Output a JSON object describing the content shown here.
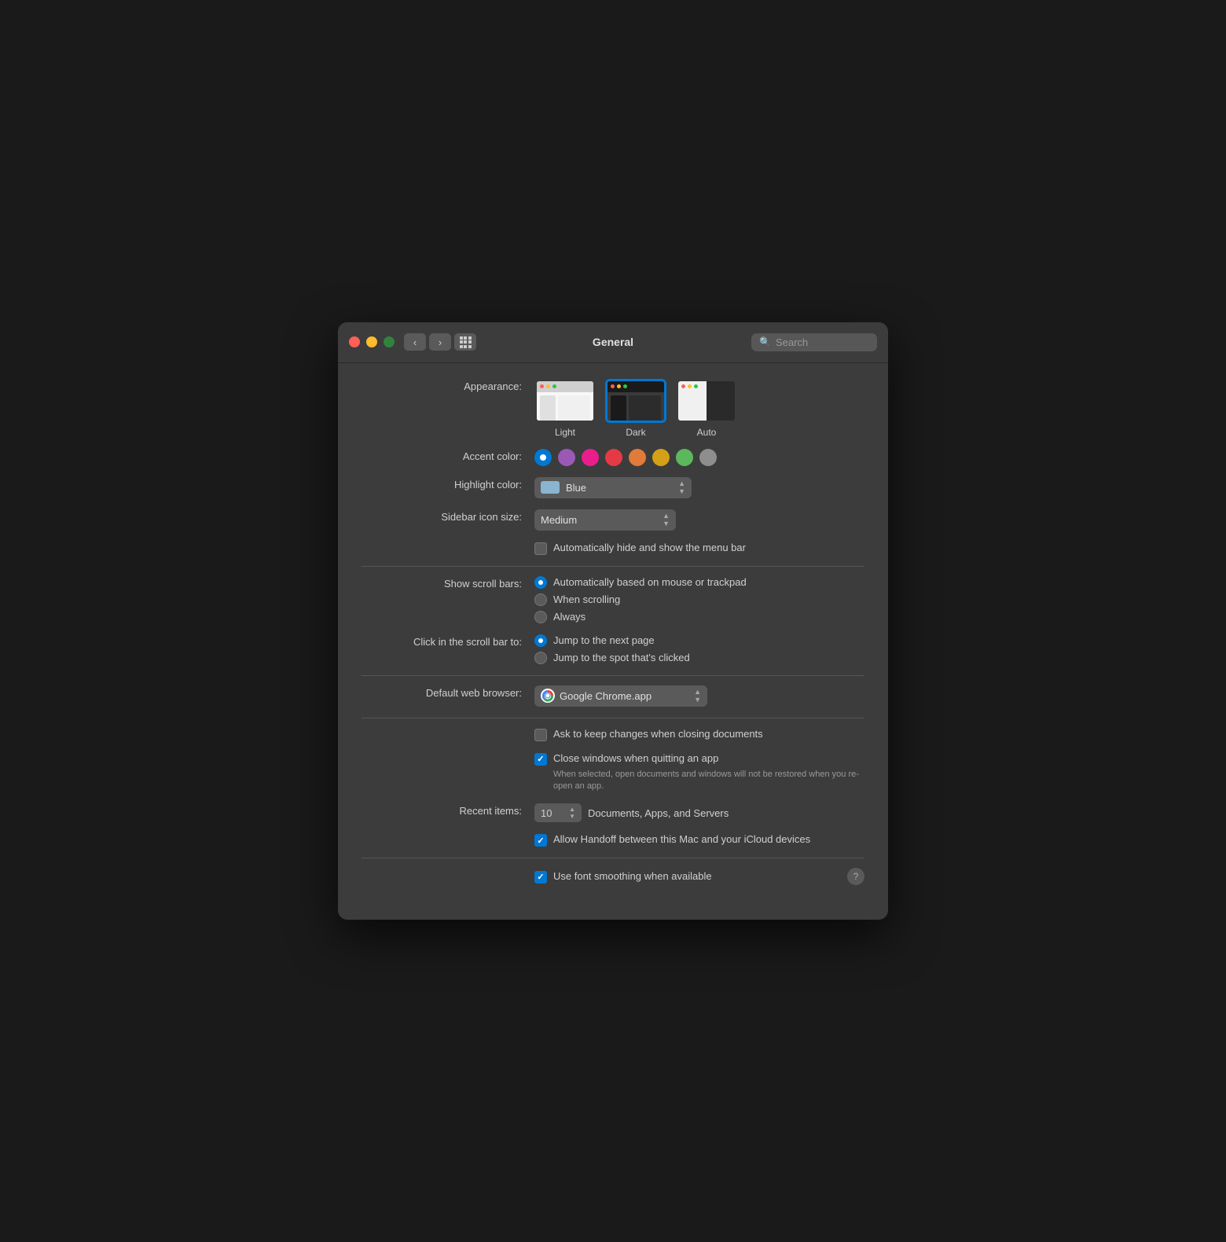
{
  "window": {
    "title": "General",
    "search_placeholder": "Search"
  },
  "appearance": {
    "label": "Appearance:",
    "options": [
      {
        "id": "light",
        "label": "Light",
        "selected": false
      },
      {
        "id": "dark",
        "label": "Dark",
        "selected": true
      },
      {
        "id": "auto",
        "label": "Auto",
        "selected": false
      }
    ]
  },
  "accent_color": {
    "label": "Accent color:",
    "colors": [
      {
        "name": "blue",
        "hex": "#0078d4",
        "selected": true
      },
      {
        "name": "purple",
        "hex": "#9b59b6",
        "selected": false
      },
      {
        "name": "pink",
        "hex": "#e91e8c",
        "selected": false
      },
      {
        "name": "red",
        "hex": "#e63946",
        "selected": false
      },
      {
        "name": "orange",
        "hex": "#e07b39",
        "selected": false
      },
      {
        "name": "yellow",
        "hex": "#d4a017",
        "selected": false
      },
      {
        "name": "green",
        "hex": "#5cb85c",
        "selected": false
      },
      {
        "name": "graphite",
        "hex": "#8e8e8e",
        "selected": false
      }
    ]
  },
  "highlight_color": {
    "label": "Highlight color:",
    "value": "Blue"
  },
  "sidebar_icon_size": {
    "label": "Sidebar icon size:",
    "value": "Medium"
  },
  "menu_bar": {
    "label": "",
    "checkbox_label": "Automatically hide and show the menu bar",
    "checked": false
  },
  "show_scroll_bars": {
    "label": "Show scroll bars:",
    "options": [
      {
        "id": "auto",
        "label": "Automatically based on mouse or trackpad",
        "selected": true
      },
      {
        "id": "when_scrolling",
        "label": "When scrolling",
        "selected": false
      },
      {
        "id": "always",
        "label": "Always",
        "selected": false
      }
    ]
  },
  "click_scroll_bar": {
    "label": "Click in the scroll bar to:",
    "options": [
      {
        "id": "next_page",
        "label": "Jump to the next page",
        "selected": true
      },
      {
        "id": "spot_clicked",
        "label": "Jump to the spot that's clicked",
        "selected": false
      }
    ]
  },
  "default_browser": {
    "label": "Default web browser:",
    "value": "Google Chrome.app"
  },
  "ask_keep_changes": {
    "label": "Ask to keep changes when closing documents",
    "checked": false
  },
  "close_windows": {
    "label": "Close windows when quitting an app",
    "checked": true,
    "note": "When selected, open documents and windows will not be restored when you re-open an app."
  },
  "recent_items": {
    "label": "Recent items:",
    "value": "10",
    "description": "Documents, Apps, and Servers"
  },
  "handoff": {
    "label": "Allow Handoff between this Mac and your iCloud devices",
    "checked": true
  },
  "font_smoothing": {
    "label": "Use font smoothing when available",
    "checked": true
  }
}
